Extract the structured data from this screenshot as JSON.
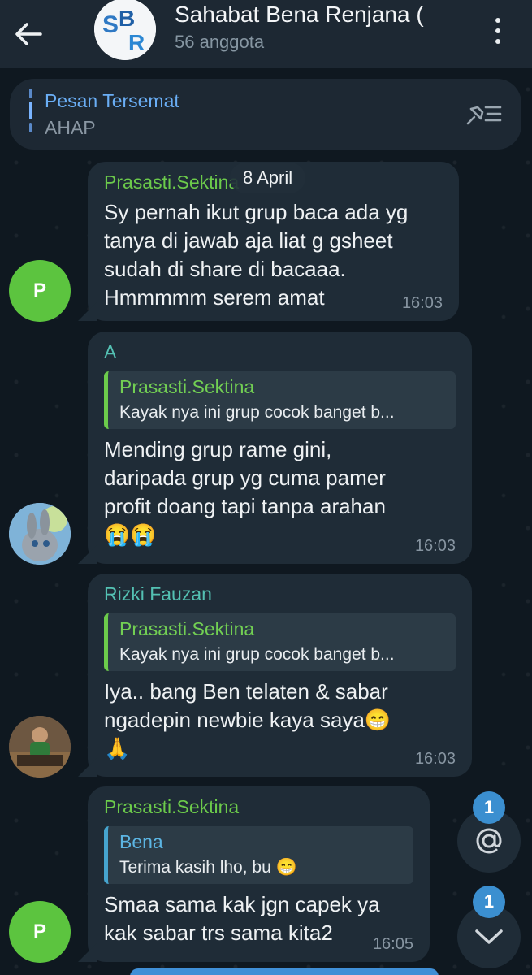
{
  "header": {
    "title": "Sahabat Bena Renjana (",
    "subtitle": "56 anggota",
    "avatar_text": "SBR"
  },
  "pinned": {
    "title": "Pesan Tersemat",
    "text": "AHAP"
  },
  "date_chip": "8 April",
  "messages": [
    {
      "sender": "Prasasti.Sektina",
      "avatar": "P",
      "lines": [
        "Sy pernah ikut grup baca ada yg",
        "tanya di jawab aja liat g gsheet",
        "sudah di share di bacaaa.",
        "Hmmmmm serem amat"
      ],
      "time": "16:03"
    },
    {
      "sender": "A",
      "reply": {
        "name": "Prasasti.Sektina",
        "text": "Kayak nya ini grup cocok banget b..."
      },
      "lines": [
        "Mending grup rame gini,",
        "daripada grup yg cuma pamer",
        "profit doang tapi tanpa arahan",
        "😭😭"
      ],
      "time": "16:03"
    },
    {
      "sender": "Rizki Fauzan",
      "reply": {
        "name": "Prasasti.Sektina",
        "text": "Kayak nya ini grup cocok banget b..."
      },
      "lines": [
        "Iya.. bang Ben telaten & sabar",
        "ngadepin newbie kaya saya😁",
        "🙏"
      ],
      "time": "16:03"
    },
    {
      "sender": "Prasasti.Sektina",
      "avatar": "P",
      "reply": {
        "name": "Bena",
        "text": "Terima kasih lho, bu 😁"
      },
      "lines": [
        "Smaa sama kak jgn capek ya",
        "kak sabar trs sama kita2"
      ],
      "time": "16:05"
    }
  ],
  "fabs": {
    "mention_badge": "1",
    "scroll_badge": "1"
  },
  "colors": {
    "header_bg": "#1d2833",
    "bubble_bg": "#1f2c37",
    "sender_green": "#6ccb4b",
    "sender_teal": "#54c1b3",
    "accent_blue": "#3b8fd0"
  }
}
